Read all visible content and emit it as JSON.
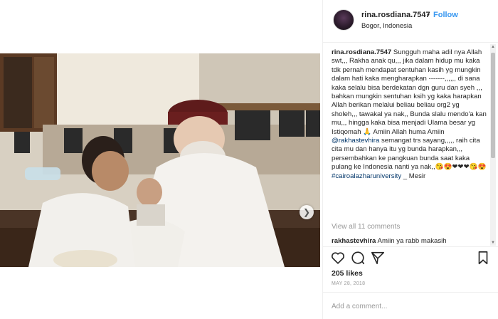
{
  "header": {
    "username": "rina.rosdiana.7547",
    "separator": "•",
    "follow_label": "Follow",
    "location": "Bogor, Indonesia"
  },
  "caption": {
    "username": "rina.rosdiana.7547",
    "text": " Sungguh maha adil nya Allah swt,,, Rakha anak qu,,, jika dalam hidup mu kaka tdk pernah mendapat sentuhan kasih yg mungkin dalam hati kaka mengharapkan -------,,,,,, di sana kaka selalu bisa berdekatan dgn guru dan syeh ,,, bahkan mungkin sentuhan ksih yg kaka harapkan Allah berikan melalui beliau beliau org2 yg sholeh,,, tawakal ya nak,, Bunda slalu mendo'a kan mu,,, hingga kaka bisa menjadi Ulama besar yg Istiqomah 🙏 Amiin Allah huma Amiin ",
    "mention": "@rakhastevhira",
    "text2": " semangat trs sayang,,,,, raih cita cita mu dan hanya itu yg bunda harapkan,,, persembahkan ke pangkuan bunda saat kaka pulang ke Indonesia nanti ya nak,,😘😍❤❤❤😘😍 ",
    "hashtag": "#cairoalazharuniversity",
    "text3": " _ Mesir"
  },
  "comments": {
    "view_all": "View all 11 comments",
    "first_user": "rakhastevhira",
    "first_text": " Amiin ya rabb makasih"
  },
  "icons": {
    "like": "heart-icon",
    "comment": "comment-icon",
    "share": "share-icon",
    "save": "bookmark-icon",
    "carousel": "chevron-right-icon"
  },
  "likes": "205 likes",
  "date": "MAY 28, 2018",
  "add_comment": {
    "placeholder": "Add a comment..."
  },
  "colors": {
    "link": "#003569",
    "follow": "#3897f0",
    "muted": "#999999",
    "text": "#262626"
  }
}
